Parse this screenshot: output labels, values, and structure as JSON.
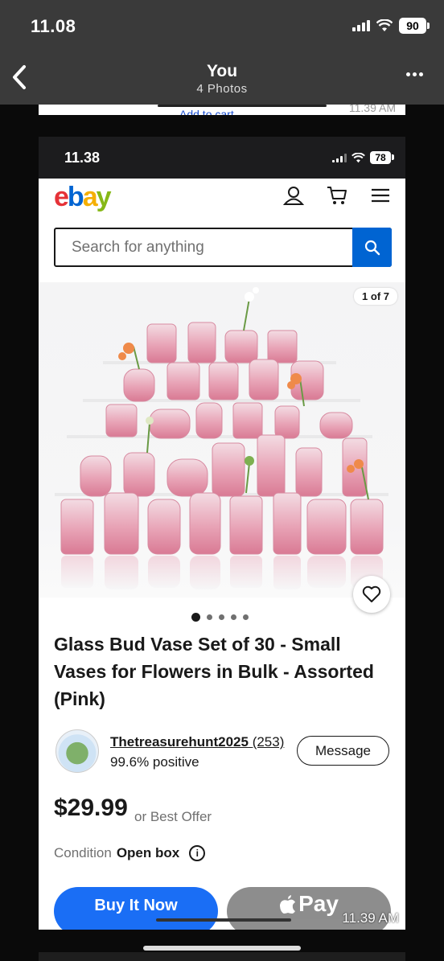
{
  "outer": {
    "time": "11.08",
    "battery": "90",
    "title": "You",
    "subtitle": "4 Photos",
    "back_icon": "chevron-left-icon",
    "more_icon": "ellipsis-icon"
  },
  "peek": {
    "link": "Add to cart",
    "time": "11.39 AM"
  },
  "inner_status": {
    "time": "11.38",
    "battery": "78"
  },
  "ebay": {
    "logo": {
      "e": "e",
      "b": "b",
      "a": "a",
      "y": "y"
    },
    "search": {
      "placeholder": "Search for anything"
    },
    "icons": [
      "account-icon",
      "cart-icon",
      "menu-icon",
      "search-icon"
    ]
  },
  "listing": {
    "image_counter": "1 of 7",
    "image_dots": {
      "count": 5,
      "active": 1
    },
    "title": "Glass Bud Vase Set of 30 - Small Vases for Flowers in Bulk - Assorted (Pink)",
    "seller": {
      "name": "Thetreasurehunt2025",
      "count": "(253)",
      "positive": "99.6% positive",
      "message_label": "Message"
    },
    "price": "$29.99",
    "price_sub": "or Best Offer",
    "condition_label": "Condition",
    "condition_value": "Open box",
    "buy_label": "Buy It Now",
    "pay_label": "Pay"
  },
  "stamp_time": "11.39 AM",
  "colors": {
    "ebay_blue": "#0064d2",
    "buy_blue": "#1a6ef5",
    "logo_e": "#e53238",
    "logo_b": "#0064d2",
    "logo_a": "#f5af02",
    "logo_y": "#86b817",
    "vase_pink": "#e8a3b6"
  }
}
